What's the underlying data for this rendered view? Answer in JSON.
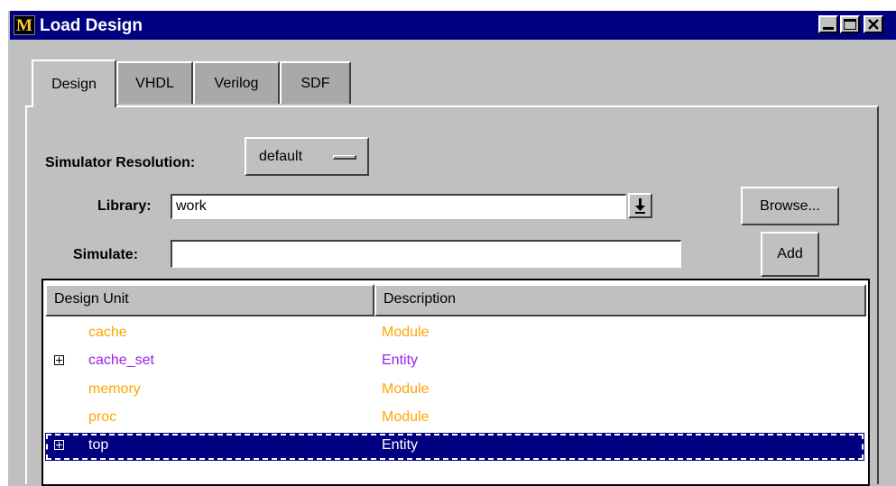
{
  "window": {
    "title": "Load Design",
    "icon_letter": "M"
  },
  "tabs": [
    {
      "label": "Design",
      "active": true
    },
    {
      "label": "VHDL",
      "active": false
    },
    {
      "label": "Verilog",
      "active": false
    },
    {
      "label": "SDF",
      "active": false
    }
  ],
  "form": {
    "resolution_label": "Simulator Resolution:",
    "resolution_value": "default",
    "library_label": "Library:",
    "library_value": "work",
    "simulate_label": "Simulate:",
    "simulate_value": "",
    "browse_label": "Browse...",
    "add_label": "Add"
  },
  "table": {
    "columns": [
      "Design Unit",
      "Description"
    ],
    "rows": [
      {
        "name": "cache",
        "description": "Module",
        "expandable": false,
        "color": "#ffa500"
      },
      {
        "name": "cache_set",
        "description": "Entity",
        "expandable": true,
        "color": "#a020f0"
      },
      {
        "name": "memory",
        "description": "Module",
        "expandable": false,
        "color": "#ffa500"
      },
      {
        "name": "proc",
        "description": "Module",
        "expandable": false,
        "color": "#ffa500"
      },
      {
        "name": "top",
        "description": "Entity",
        "expandable": true,
        "color": "#a020f0",
        "selected": true
      }
    ]
  },
  "colors": {
    "titlebar": "#000080",
    "face": "#c0c0c0",
    "module": "#ffa500",
    "entity": "#a020f0",
    "selection": "#000080"
  }
}
